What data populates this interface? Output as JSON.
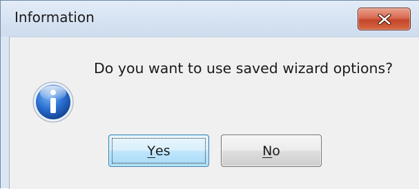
{
  "dialog": {
    "title": "Information",
    "message": "Do you want to use saved wizard options?"
  },
  "icons": {
    "close": "close-icon",
    "info": "info-icon"
  },
  "buttons": {
    "yes": {
      "accelerator": "Y",
      "rest": "es"
    },
    "no": {
      "accelerator": "N",
      "rest": "o"
    }
  },
  "colors": {
    "close_button": "#d25a3c",
    "info_icon_blue": "#1f5fbf",
    "focused_button_border": "#3c7fb1"
  }
}
